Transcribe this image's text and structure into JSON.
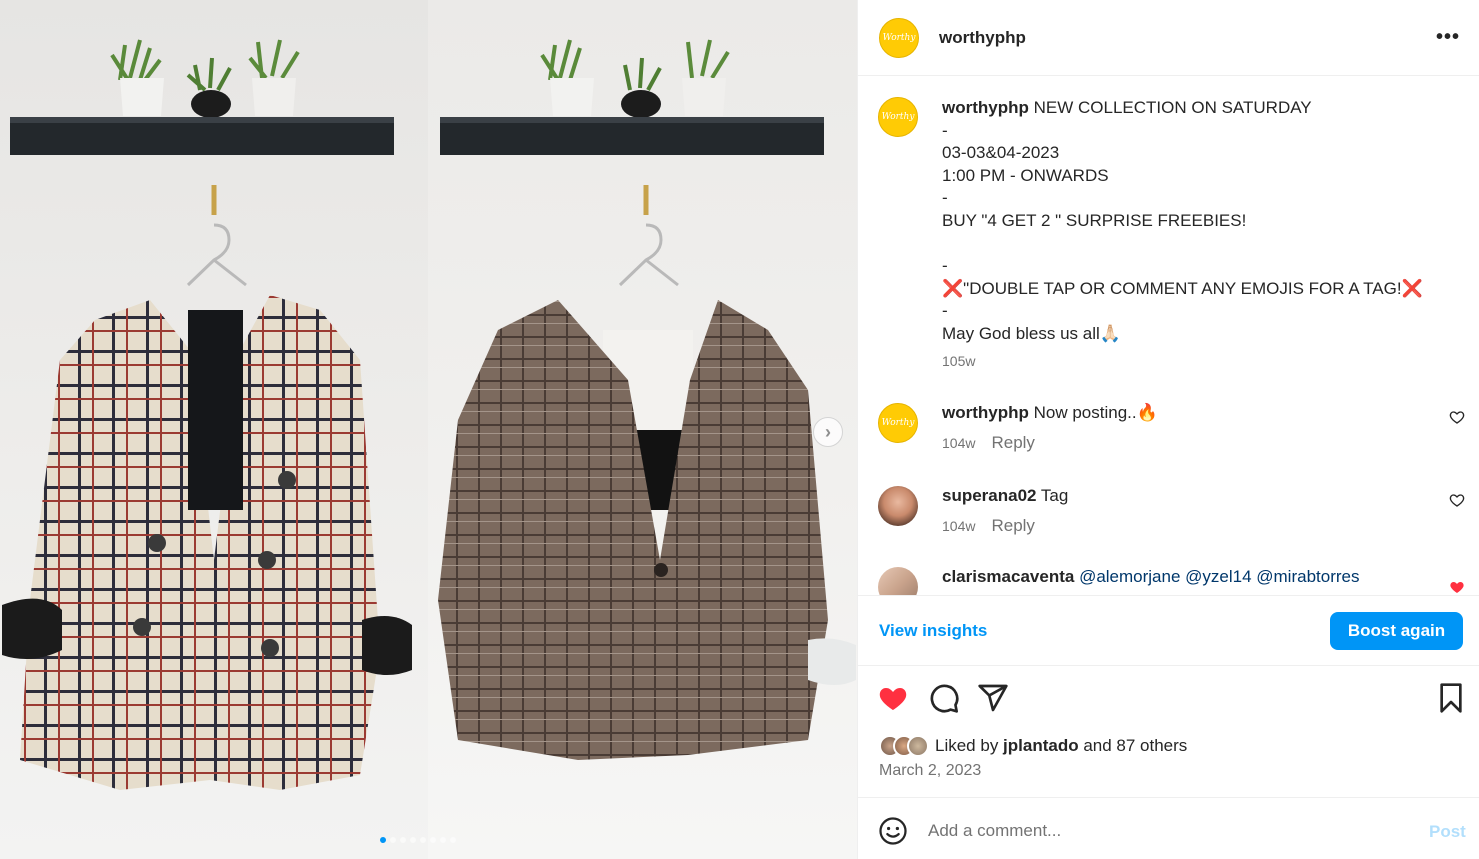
{
  "colors": {
    "accent": "#0095f6",
    "like": "#ff3040",
    "brand_yellow": "#ffcb05",
    "text": "#262626",
    "muted": "#737373"
  },
  "media": {
    "next_icon": "chevron-right-icon",
    "next_glyph": "›",
    "slide_count": 8,
    "active_slide": 0
  },
  "header": {
    "username": "worthyphp",
    "more_icon": "more-horizontal-icon",
    "more_glyph": "•••",
    "avatar_logo": "Worthy"
  },
  "caption": {
    "username": "worthyphp",
    "text": "NEW COLLECTION ON SATURDAY\n-\n03-03&04-2023\n1:00 PM - ONWARDS\n-\nBUY \"4 GET 2 \" SURPRISE FREEBIES!\n\n-\n❌\"DOUBLE TAP OR COMMENT ANY EMOJIS FOR A TAG!❌\n-\nMay God bless us all🙏🏻",
    "time": "105w"
  },
  "comments": [
    {
      "username": "worthyphp",
      "text": "Now posting..🔥",
      "time": "104w",
      "reply": "Reply",
      "liked": false
    },
    {
      "username": "superana02",
      "text": "Tag",
      "time": "104w",
      "reply": "Reply",
      "liked": false
    },
    {
      "username": "clarismacaventa",
      "text": "@alemorjane @yzel14 @mirabtorres",
      "liked": true
    }
  ],
  "insights": {
    "view_label": "View insights",
    "boost_label": "Boost again"
  },
  "actions": {
    "like_icon": "heart-filled-icon",
    "comment_icon": "comment-icon",
    "share_icon": "share-icon",
    "save_icon": "bookmark-icon"
  },
  "likes": {
    "prefix": "Liked by ",
    "user": "jplantado",
    "suffix": " and 87 others"
  },
  "date": "March 2, 2023",
  "add_comment": {
    "placeholder": "Add a comment...",
    "post_label": "Post",
    "emoji_icon": "smiley-icon"
  }
}
